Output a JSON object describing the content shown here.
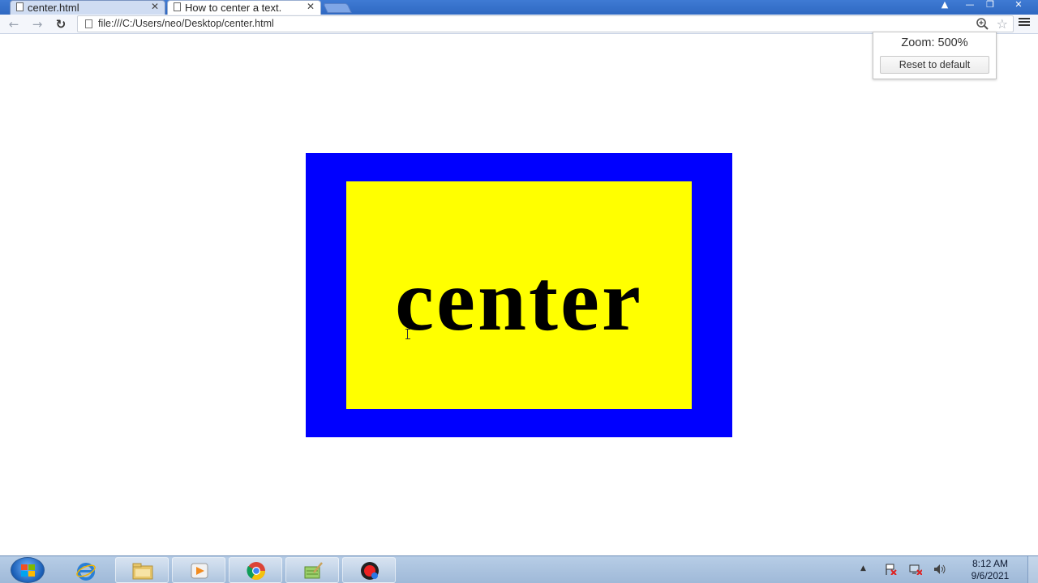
{
  "browser": {
    "tabs": [
      {
        "title": "center.html"
      },
      {
        "title": "How to center a text."
      }
    ],
    "address": "file:///C:/Users/neo/Desktop/center.html",
    "zoom": {
      "label": "Zoom: 500%",
      "reset_label": "Reset to default"
    }
  },
  "page": {
    "text": "center",
    "colors": {
      "outer": "#0000ff",
      "inner": "#ffff00",
      "text": "#000000"
    }
  },
  "taskbar": {
    "pinned": [
      "start-icon",
      "internet-explorer-icon",
      "file-explorer-icon",
      "media-player-icon",
      "chrome-icon",
      "notepad-icon",
      "screen-recorder-icon"
    ],
    "clock": {
      "time": "8:12 AM",
      "date": "9/6/2021"
    }
  }
}
